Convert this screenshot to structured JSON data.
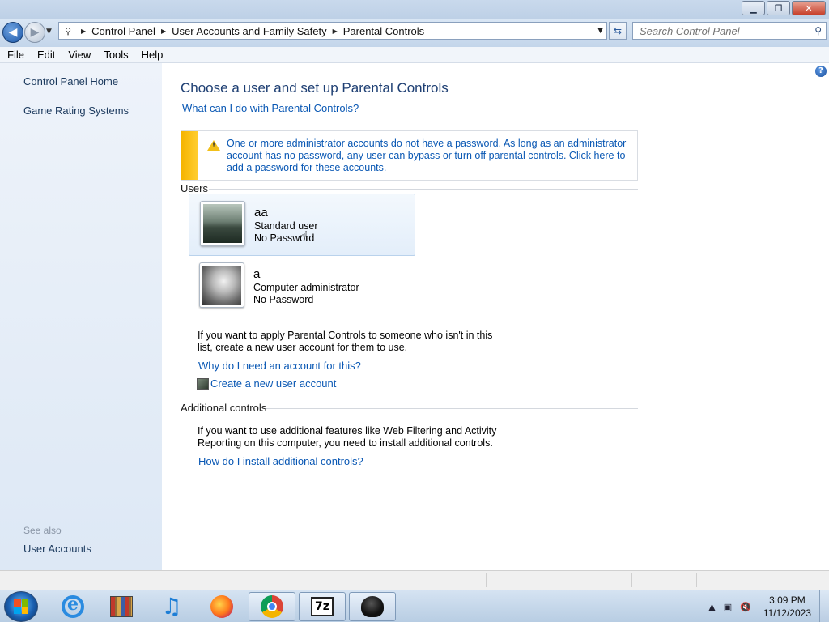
{
  "window": {
    "minimize": "▁",
    "maximize": "❐",
    "close": "✕"
  },
  "address": {
    "breadcrumbs": [
      "Control Panel",
      "User Accounts and Family Safety",
      "Parental Controls"
    ],
    "search_placeholder": "Search Control Panel"
  },
  "menu": [
    "File",
    "Edit",
    "View",
    "Tools",
    "Help"
  ],
  "sidebar": {
    "links": [
      "Control Panel Home",
      "Game Rating Systems"
    ],
    "see_also_label": "See also",
    "see_also_links": [
      "User Accounts"
    ]
  },
  "main": {
    "title": "Choose a user and set up Parental Controls",
    "help_link": "What can I do with Parental Controls?",
    "warning": "One or more administrator accounts do not have a password. As long as an administrator account has no password, any user can bypass or turn off parental controls. Click here to add a password for these accounts.",
    "users_heading": "Users",
    "users": [
      {
        "name": "aa",
        "type": "Standard user",
        "password": "No Password"
      },
      {
        "name": "a",
        "type": "Computer administrator",
        "password": "No Password"
      }
    ],
    "new_account_text": "If you want to apply Parental Controls to someone who isn't in this list, create a new user account for them to use.",
    "why_link": "Why do I need an account for this?",
    "create_link": "Create a new user account",
    "additional_heading": "Additional controls",
    "additional_text": "If you want to use additional features like Web Filtering and Activity Reporting on this computer, you need to install additional controls.",
    "install_link": "How do I install additional controls?"
  },
  "taskbar": {
    "apps": [
      "internet-explorer",
      "library",
      "itunes",
      "firefox",
      "chrome",
      "7-zip",
      "control-panel"
    ],
    "zip_label": "7z",
    "time": "3:09 PM",
    "date": "11/12/2023"
  },
  "colors": {
    "accent_link": "#0a58b4",
    "title": "#1e3f73",
    "warning_bar": "#f5b400"
  }
}
